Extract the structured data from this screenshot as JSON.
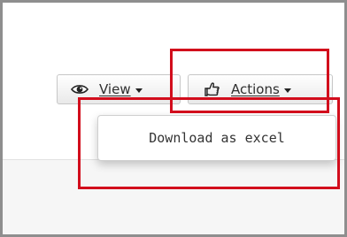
{
  "toolbar": {
    "view_label": "View",
    "actions_label": "Actions",
    "view_icon": "eye-icon",
    "actions_icon": "pointing-hand-icon",
    "dropdown_icon": "caret-down-icon"
  },
  "actions_menu": {
    "items": [
      {
        "label": "Download as excel"
      }
    ]
  },
  "highlights": {
    "color": "#d20d1c"
  }
}
